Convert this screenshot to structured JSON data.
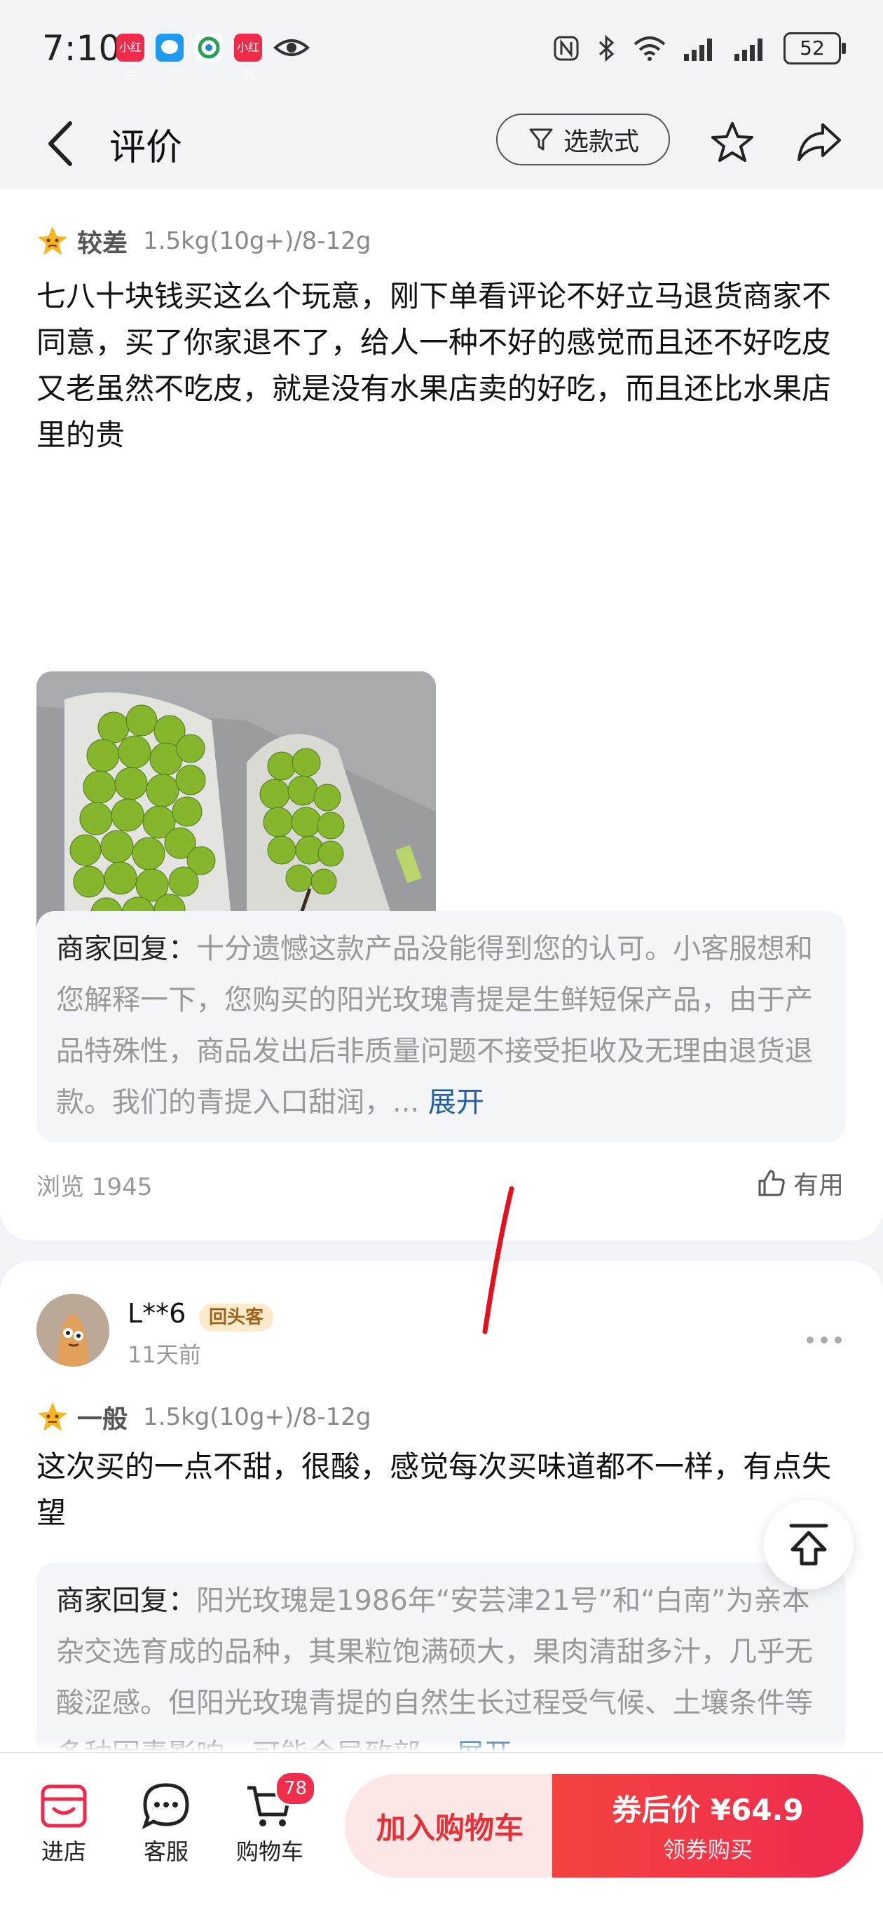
{
  "status": {
    "time": "7:10",
    "battery": "52"
  },
  "nav": {
    "title": "评价",
    "filter_label": "选款式"
  },
  "reviews": [
    {
      "rating_word": "较差",
      "spec": "1.5kg(10g+)/8-12g",
      "text": "七八十块钱买这么个玩意，刚下单看评论不好立马退货商家不同意，买了你家退不了，给人一种不好的感觉而且还不好吃皮又老虽然不吃皮，就是没有水果店卖的好吃，而且还比水果店里的贵",
      "reply_label": "商家回复：",
      "reply_text": "十分遗憾这款产品没能得到您的认可。小客服想和您解释一下，您购买的阳光玫瑰青提是生鲜短保产品，由于产品特殊性，商品发出后非质量问题不接受拒收及无理由退货退款。我们的青提入口甜润，...",
      "expand": "展开",
      "views": "浏览 1945",
      "useful": "有用"
    },
    {
      "username": "L**6",
      "badge": "回头客",
      "time_ago": "11天前",
      "rating_word": "一般",
      "spec": "1.5kg(10g+)/8-12g",
      "text": "这次买的一点不甜，很酸，感觉每次买味道都不一样，有点失望",
      "reply_label": "商家回复：",
      "reply_text": "阳光玫瑰是1986年“安芸津21号”和“白南”为亲本杂交选育成的品种，其果粒饱满硕大，果肉清甜多汁，几乎无酸涩感。但阳光玫瑰青提的自然生长过程受气候、土壤条件等多种因素影响，可能会导致部...",
      "expand": "展开"
    }
  ],
  "bottom": {
    "store": "进店",
    "service": "客服",
    "cart": "购物车",
    "cart_count": "78",
    "add_cart": "加入购物车",
    "buy_price": "券后价 ¥64.9",
    "buy_sub": "领券购买"
  }
}
